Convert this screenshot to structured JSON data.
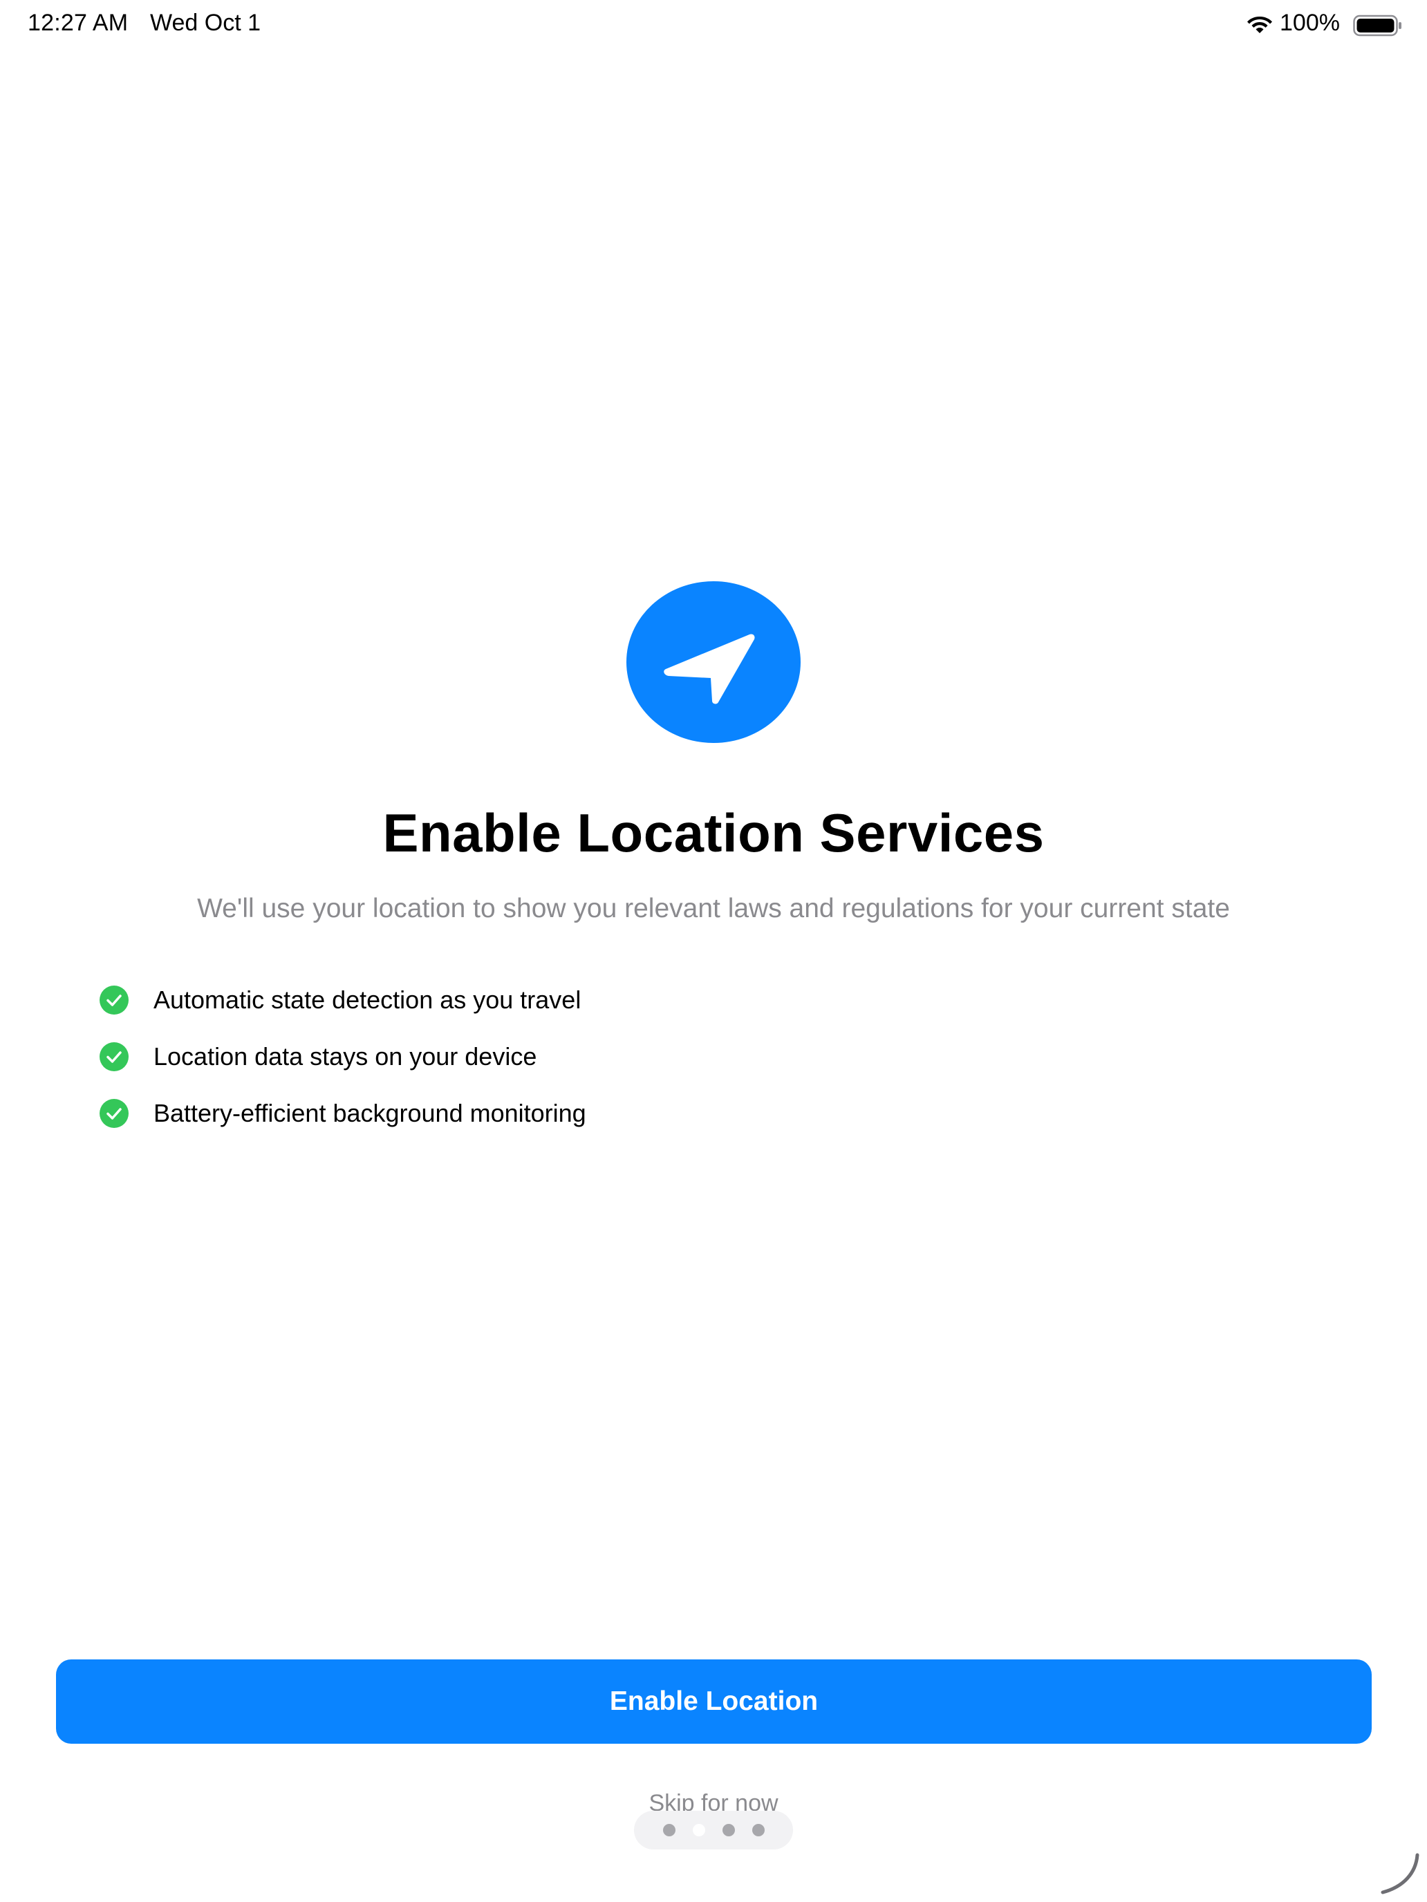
{
  "status_bar": {
    "time": "12:27 AM",
    "date": "Wed Oct 1",
    "battery_percent": "100%",
    "wifi_icon": "wifi-icon",
    "battery_icon": "battery-full-icon"
  },
  "hero": {
    "icon": "location-arrow-icon",
    "icon_color": "#0a84ff"
  },
  "title": "Enable Location Services",
  "subtitle": "We'll use your location to show you relevant laws and regulations for your current state",
  "features": [
    {
      "icon": "checkmark-circle-icon",
      "label": "Automatic state detection as you travel"
    },
    {
      "icon": "checkmark-circle-icon",
      "label": "Location data stays on your device"
    },
    {
      "icon": "checkmark-circle-icon",
      "label": "Battery-efficient background monitoring"
    }
  ],
  "colors": {
    "accent": "#0a84ff",
    "check": "#34c759",
    "secondary_text": "#8a8a8e"
  },
  "primary_button": {
    "label": "Enable Location"
  },
  "skip_link": {
    "label": "Skip for now"
  },
  "page_indicator": {
    "page_count": 4,
    "current_page": 2
  }
}
